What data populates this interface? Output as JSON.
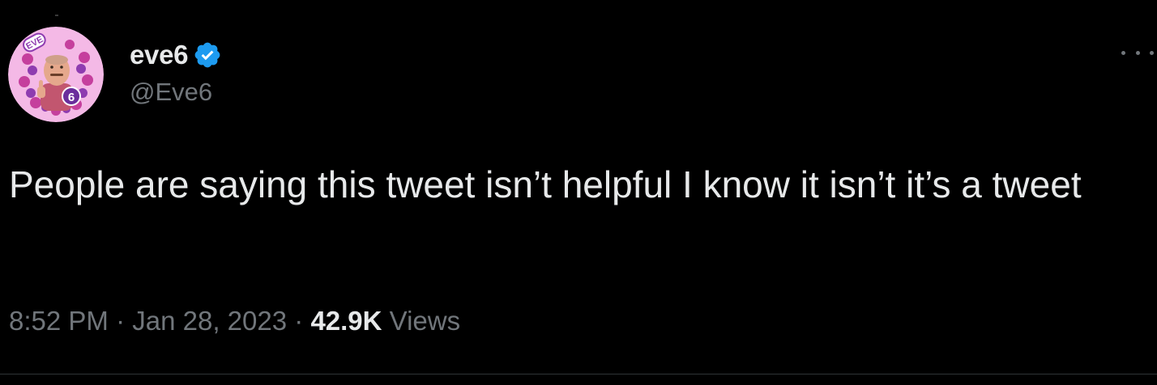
{
  "user": {
    "display_name": "eve6",
    "handle": "@Eve6",
    "verified": true,
    "avatar_badge_text": "EVE",
    "avatar_number": "6"
  },
  "tweet": {
    "text": "People are saying this tweet isn’t helpful I know it isn’t it’s a tweet",
    "time": "8:52 PM",
    "separator": "·",
    "date": "Jan 28, 2023",
    "views_count": "42.9K",
    "views_label": "Views"
  },
  "icons": {
    "verified": "verified-badge-icon",
    "more": "more-options-icon"
  },
  "colors": {
    "background": "#000000",
    "primary_text": "#e7e9ea",
    "secondary_text": "#71767b",
    "verified_blue": "#1d9bf0",
    "avatar_pink": "#f4b9e6",
    "avatar_purple": "#9b3fb0",
    "divider": "#2f3336"
  }
}
